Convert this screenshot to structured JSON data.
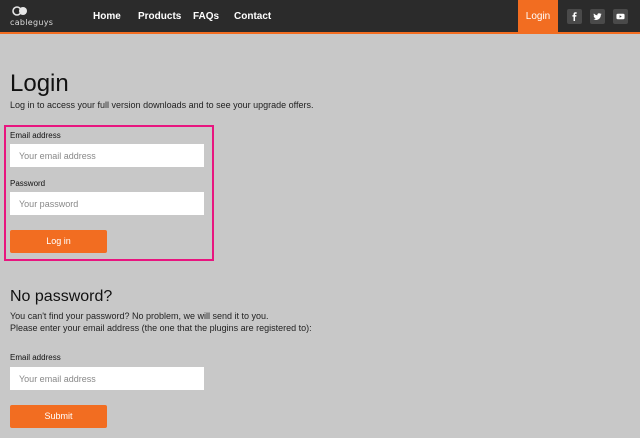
{
  "header": {
    "logo_text": "cableguys",
    "nav": [
      "Home",
      "Products",
      "FAQs",
      "Contact"
    ],
    "login_tab": "Login",
    "social_icons": [
      "facebook-icon",
      "twitter-icon",
      "youtube-icon"
    ],
    "accent_color": "#f26d21",
    "bar_color": "#2b2b2b"
  },
  "login": {
    "title": "Login",
    "intro": "Log in to access your full version downloads and to see your upgrade offers.",
    "email_label": "Email address",
    "email_placeholder": "Your email address",
    "password_label": "Password",
    "password_placeholder": "Your password",
    "submit_label": "Log in",
    "highlight_color": "#e8157f"
  },
  "no_password": {
    "title": "No password?",
    "line1": "You can't find your password? No problem, we will send it to you.",
    "line2": "Please enter your email address (the one that the plugins are registered to):",
    "email_label": "Email address",
    "email_placeholder": "Your email address",
    "submit_label": "Submit"
  }
}
